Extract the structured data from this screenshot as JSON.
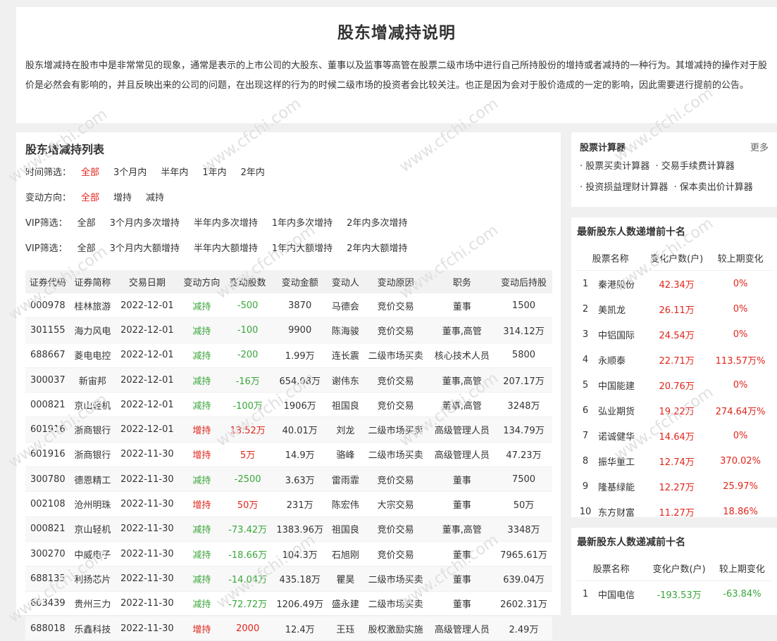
{
  "header": {
    "title": "股东增减持说明",
    "intro": "股东增减持在股市中是非常常见的现象，通常是表示的上市公司的大股东、董事以及监事等高管在股票二级市场中进行自己所持股份的增持或者减持的一种行为。其增减持的操作对于股价是必然会有影响的，并且反映出来的公司的问题，在出现这样的行为的时候二级市场的投资者会比较关注。也正是因为会对于股价造成的一定的影响，因此需要进行提前的公告。"
  },
  "list": {
    "title": "股东增减持列表",
    "filters": [
      {
        "label": "时间筛选：",
        "options": [
          "全部",
          "3个月内",
          "半年内",
          "1年内",
          "2年内"
        ],
        "active": 0
      },
      {
        "label": "变动方向：",
        "options": [
          "全部",
          "增持",
          "减持"
        ],
        "active": 0
      },
      {
        "label": "VIP筛选：",
        "options": [
          "全部",
          "3个月内多次增持",
          "半年内多次增持",
          "1年内多次增持",
          "2年内多次增持"
        ],
        "active": -1
      },
      {
        "label": "VIP筛选：",
        "options": [
          "全部",
          "3个月内大额增持",
          "半年内大额增持",
          "1年内大额增持",
          "2年内大额增持"
        ],
        "active": -1
      }
    ],
    "columns": [
      "证券代码",
      "证券简称",
      "交易日期",
      "变动方向",
      "变动股数",
      "变动金额",
      "变动人",
      "变动原因",
      "职务",
      "变动后持股"
    ],
    "rows": [
      [
        "000978",
        "桂林旅游",
        "2022-12-01",
        "减持",
        "-500",
        "3870",
        "马德会",
        "竞价交易",
        "董事",
        "1500"
      ],
      [
        "301155",
        "海力风电",
        "2022-12-01",
        "减持",
        "-100",
        "9900",
        "陈海骏",
        "竞价交易",
        "董事,高管",
        "314.12万"
      ],
      [
        "688667",
        "菱电电控",
        "2022-12-01",
        "减持",
        "-200",
        "1.99万",
        "连长震",
        "二级市场买卖",
        "核心技术人员",
        "5800"
      ],
      [
        "300037",
        "新宙邦",
        "2022-12-01",
        "减持",
        "-16万",
        "654.08万",
        "谢伟东",
        "竞价交易",
        "董事,高管",
        "207.17万"
      ],
      [
        "000821",
        "京山轻机",
        "2022-12-01",
        "减持",
        "-100万",
        "1906万",
        "祖国良",
        "竞价交易",
        "董事,高管",
        "3248万"
      ],
      [
        "601916",
        "浙商银行",
        "2022-12-01",
        "增持",
        "13.52万",
        "40.01万",
        "刘龙",
        "二级市场买卖",
        "高级管理人员",
        "134.79万"
      ],
      [
        "601916",
        "浙商银行",
        "2022-11-30",
        "增持",
        "5万",
        "14.9万",
        "骆峰",
        "二级市场买卖",
        "高级管理人员",
        "47.23万"
      ],
      [
        "300780",
        "德恩精工",
        "2022-11-30",
        "减持",
        "-2500",
        "3.63万",
        "雷雨霏",
        "竞价交易",
        "董事",
        "7500"
      ],
      [
        "002108",
        "沧州明珠",
        "2022-11-30",
        "增持",
        "50万",
        "231万",
        "陈宏伟",
        "大宗交易",
        "董事",
        "50万"
      ],
      [
        "000821",
        "京山轻机",
        "2022-11-30",
        "减持",
        "-73.42万",
        "1383.96万",
        "祖国良",
        "竞价交易",
        "董事,高管",
        "3348万"
      ],
      [
        "300270",
        "中威电子",
        "2022-11-30",
        "减持",
        "-18.66万",
        "104.3万",
        "石旭刚",
        "竞价交易",
        "董事",
        "7965.61万"
      ],
      [
        "688135",
        "利扬芯片",
        "2022-11-30",
        "减持",
        "-14.04万",
        "435.18万",
        "瞿昊",
        "二级市场买卖",
        "董事",
        "639.04万"
      ],
      [
        "603439",
        "贵州三力",
        "2022-11-30",
        "减持",
        "-72.72万",
        "1206.49万",
        "盛永建",
        "二级市场买卖",
        "董事",
        "2602.31万"
      ],
      [
        "688018",
        "乐鑫科技",
        "2022-11-30",
        "增持",
        "2000",
        "12.4万",
        "王珏",
        "股权激励实施",
        "高级管理人员",
        "2.49万"
      ]
    ]
  },
  "calculator": {
    "title": "股票计算器",
    "more": "更多",
    "links": [
      "· 股票买卖计算器",
      "· 交易手续费计算器",
      "· 投资损益理财计算器",
      "· 保本卖出价计算器"
    ]
  },
  "increase_rank": {
    "title": "最新股东人数递增前十名",
    "columns": [
      "股票名称",
      "变化户数(户)",
      "较上期变化"
    ],
    "rows": [
      [
        "1",
        "秦港股份",
        "42.34万",
        "0%"
      ],
      [
        "2",
        "美凯龙",
        "26.11万",
        "0%"
      ],
      [
        "3",
        "中铝国际",
        "24.54万",
        "0%"
      ],
      [
        "4",
        "永顺泰",
        "22.71万",
        "113.57万%"
      ],
      [
        "5",
        "中国能建",
        "20.76万",
        "0%"
      ],
      [
        "6",
        "弘业期货",
        "19.22万",
        "274.64万%"
      ],
      [
        "7",
        "诺诚健华",
        "14.64万",
        "0%"
      ],
      [
        "8",
        "振华重工",
        "12.74万",
        "370.02%"
      ],
      [
        "9",
        "隆基绿能",
        "12.27万",
        "25.97%"
      ],
      [
        "10",
        "东方财富",
        "11.27万",
        "18.86%"
      ]
    ]
  },
  "decrease_rank": {
    "title": "最新股东人数递减前十名",
    "columns": [
      "股票名称",
      "变化户数(户)",
      "较上期变化"
    ],
    "rows": [
      [
        "1",
        "中国电信",
        "-193.53万",
        "-63.84%"
      ]
    ]
  },
  "colors": {
    "red": "#e1251b",
    "green": "#3aa63a",
    "bg": "#f0f0f0"
  },
  "watermark": "www.cfchi.com"
}
